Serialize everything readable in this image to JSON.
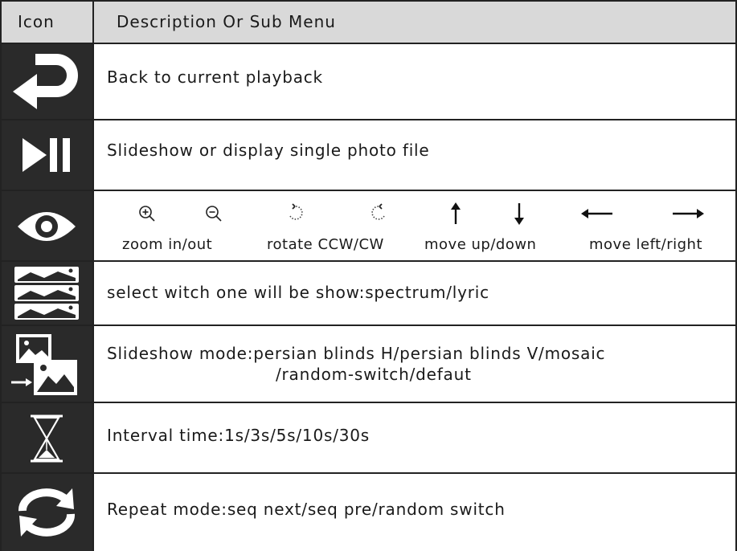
{
  "header": {
    "col_icon": "Icon",
    "col_desc": "Description Or Sub Menu"
  },
  "rows": [
    {
      "icon": "return-arrow-icon",
      "description": "Back to current playback"
    },
    {
      "icon": "play-pause-icon",
      "description": "Slideshow or display single photo file"
    },
    {
      "icon": "eye-icon",
      "submenu": {
        "icons": [
          "zoom-in-icon",
          "zoom-out-icon",
          "rotate-ccw-icon",
          "rotate-cw-icon",
          "arrow-up-icon",
          "arrow-down-icon",
          "arrow-left-icon",
          "arrow-right-icon"
        ],
        "labels": [
          "zoom in/out",
          "rotate CCW/CW",
          "move up/down",
          "move left/right"
        ]
      }
    },
    {
      "icon": "stacked-images-icon",
      "description": "select witch one will be show:spectrum/lyric"
    },
    {
      "icon": "slideshow-transition-icon",
      "description": "Slideshow mode:persian blinds H/persian blinds V/mosaic",
      "description_line2": "/random-switch/defaut"
    },
    {
      "icon": "hourglass-icon",
      "description": "Interval time:1s/3s/5s/10s/30s"
    },
    {
      "icon": "repeat-icon",
      "description": "Repeat mode:seq next/seq pre/random switch"
    }
  ],
  "colors": {
    "icon_bg": "#2a2a2a",
    "header_bg": "#d9d9d9",
    "grid": "#222222"
  }
}
